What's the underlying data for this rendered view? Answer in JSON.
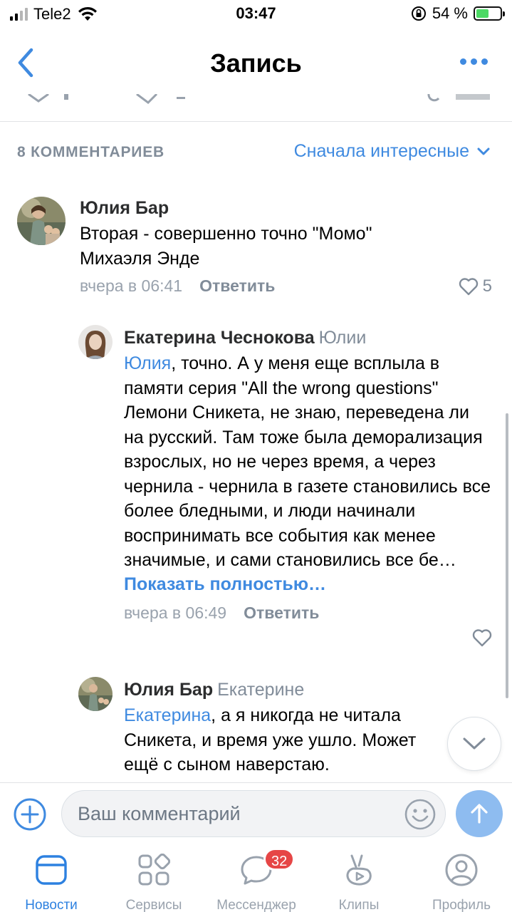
{
  "status_bar": {
    "carrier": "Tele2",
    "time": "03:47",
    "battery_percent": "54 %",
    "battery_level": 0.54
  },
  "nav": {
    "title": "Запись",
    "back_icon": "chevron-left-icon",
    "more_icon": "more-horizontal-icon"
  },
  "comments_header": {
    "count_label": "8 КОММЕНТАРИЕВ",
    "sort_label": "Сначала интересные"
  },
  "comments": [
    {
      "author": "Юлия Бар",
      "reply_to": "",
      "mention": "",
      "text": "Вторая - совершенно точно \"Момо\" Михаэля Энде",
      "time": "вчера в 06:41",
      "reply_label": "Ответить",
      "likes": "5"
    },
    {
      "author": "Екатерина Чеснокова",
      "reply_to": "Юлии",
      "mention": "Юлия",
      "text": ", точно. А у меня еще всплыла в памяти серия \"All the wrong questions\" Лемони Сникета, не знаю, переведена ли на русский. Там тоже была деморализация взрослых, но не через время, а через чернила - чернила в газете становились все более бледными, и люди начинали воспринимать все события как менее значимые, и сами становились все бе…",
      "show_more": "Показать полностью…",
      "time": "вчера в 06:49",
      "reply_label": "Ответить",
      "likes": ""
    },
    {
      "author": "Юлия Бар",
      "reply_to": "Екатерине",
      "mention": "Екатерина",
      "text": ", а я никогда не читала Сникета, и время уже ушло. Может ещё с сыном наверстаю.",
      "time": "",
      "reply_label": "",
      "likes": ""
    }
  ],
  "input": {
    "placeholder": "Ваш комментарий",
    "value": ""
  },
  "tabs": [
    {
      "label": "Новости",
      "icon": "news-icon",
      "active": true
    },
    {
      "label": "Сервисы",
      "icon": "services-icon",
      "active": false
    },
    {
      "label": "Мессенджер",
      "icon": "messenger-icon",
      "active": false,
      "badge": "32"
    },
    {
      "label": "Клипы",
      "icon": "clips-icon",
      "active": false
    },
    {
      "label": "Профиль",
      "icon": "profile-icon",
      "active": false
    }
  ],
  "colors": {
    "accent": "#3f8ae0",
    "secondary_text": "#818c99",
    "badge": "#e64646",
    "send_button": "#8ebcf0"
  }
}
